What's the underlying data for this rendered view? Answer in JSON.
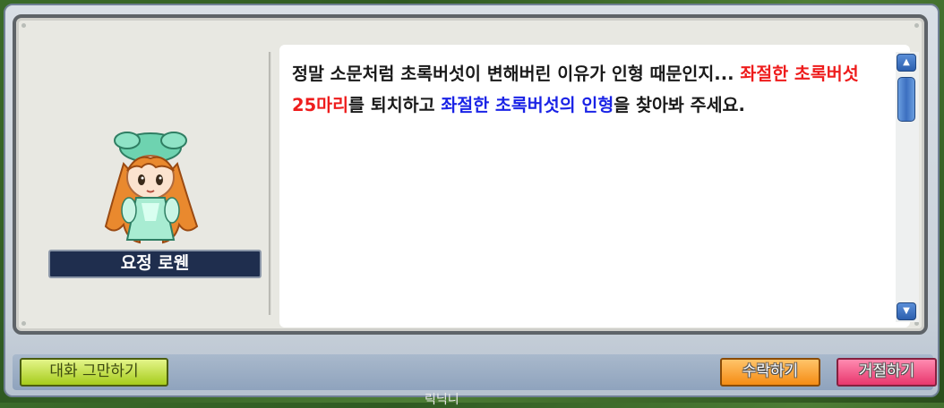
{
  "npc": {
    "name": "요정 로웬",
    "avatar_icon": "fairy-npc-portrait"
  },
  "dialog": {
    "text_1": "정말 소문처럼 초록버섯이 변해버린 이유가 인형 때문인지... ",
    "highlight_red": "좌절한 초록버섯 25마리",
    "text_2": "를 퇴치하고 ",
    "highlight_blue": "좌절한 초록버섯의 인형",
    "text_3": "을 찾아봐 주세요."
  },
  "buttons": {
    "end_chat": "대화 그만하기",
    "accept": "수락하기",
    "decline": "거절하기"
  },
  "scrollbar": {
    "up_icon": "scroll-up-icon",
    "down_icon": "scroll-down-icon"
  },
  "background": {
    "label": "릭닉니"
  },
  "colors": {
    "highlight_red": "#ee1c1c",
    "highlight_blue": "#1a23e6",
    "name_plate": "#1f2e4e",
    "accept_button": "#f58c14",
    "decline_button": "#e8376d",
    "end_button": "#a6cc1c"
  }
}
